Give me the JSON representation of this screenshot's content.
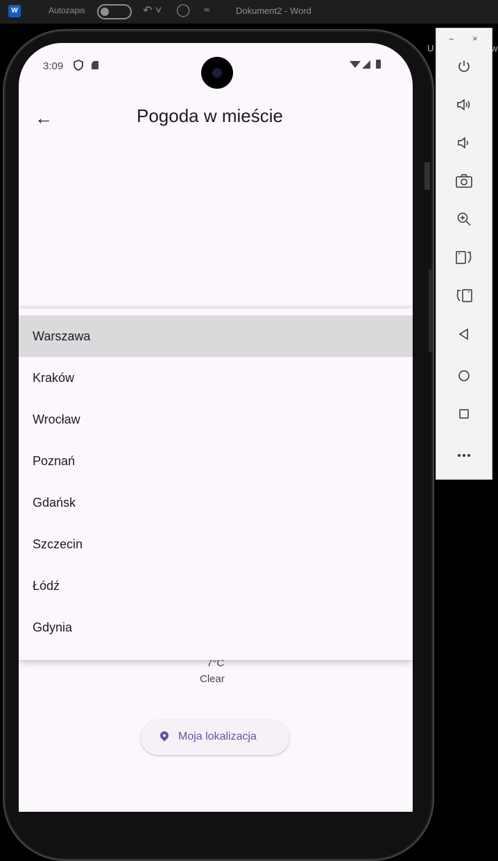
{
  "word": {
    "autosave_label": "Autozapis",
    "document_title": "Dokument2  -  Word",
    "edge_fragment": "U",
    "edge_fragment_right": "w"
  },
  "status_bar": {
    "time": "3:09"
  },
  "app_bar": {
    "title": "Pogoda w mieście"
  },
  "city_menu": {
    "selected": "Warszawa",
    "items": [
      "Warszawa",
      "Kraków",
      "Wrocław",
      "Poznań",
      "Gdańsk",
      "Szczecin",
      "Łódź",
      "Gdynia"
    ]
  },
  "weather": {
    "temperature": "7°C",
    "condition": "Clear"
  },
  "location_button": {
    "label": "Moja lokalizacja"
  },
  "emulator_toolbar": {
    "minimize": "−",
    "close": "×",
    "tools": [
      "power-icon",
      "volume-up-icon",
      "volume-down-icon",
      "screenshot-icon",
      "zoom-icon",
      "rotate-right-icon",
      "rotate-left-icon",
      "back-icon",
      "home-icon",
      "overview-icon",
      "more-icon"
    ]
  },
  "colors": {
    "accent": "#6750a4",
    "surface": "#fcf7fc",
    "selected_row": "#dcd9dd"
  }
}
